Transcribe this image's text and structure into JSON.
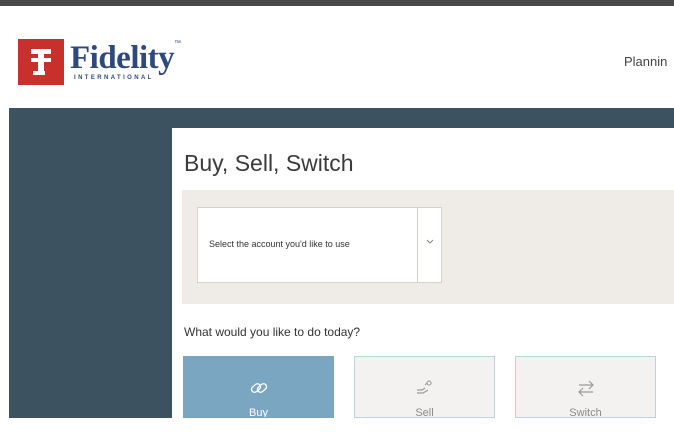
{
  "header": {
    "logo": {
      "mark": "F",
      "name": "Fidelity",
      "trademark": "™",
      "sub": "INTERNATIONAL"
    },
    "nav_item": "Plannin"
  },
  "main": {
    "title": "Buy, Sell, Switch",
    "account_select": {
      "placeholder": "Select the account you'd like to use",
      "caret_icon": "chevron-down-icon"
    },
    "question": "What would you like to do today?",
    "actions": [
      {
        "label": "Buy",
        "icon": "link-icon",
        "selected": true
      },
      {
        "label": "Sell",
        "icon": "sell-hand-icon",
        "selected": false
      },
      {
        "label": "Switch",
        "icon": "swap-arrows-icon",
        "selected": false
      }
    ]
  },
  "colors": {
    "brand_red": "#c8312b",
    "brand_navy": "#2e4a7d",
    "panel_slate": "#3d5261",
    "band_beige": "#efebe7",
    "buy_blue": "#7aa6c2",
    "action_border": "#b9d3e3"
  }
}
